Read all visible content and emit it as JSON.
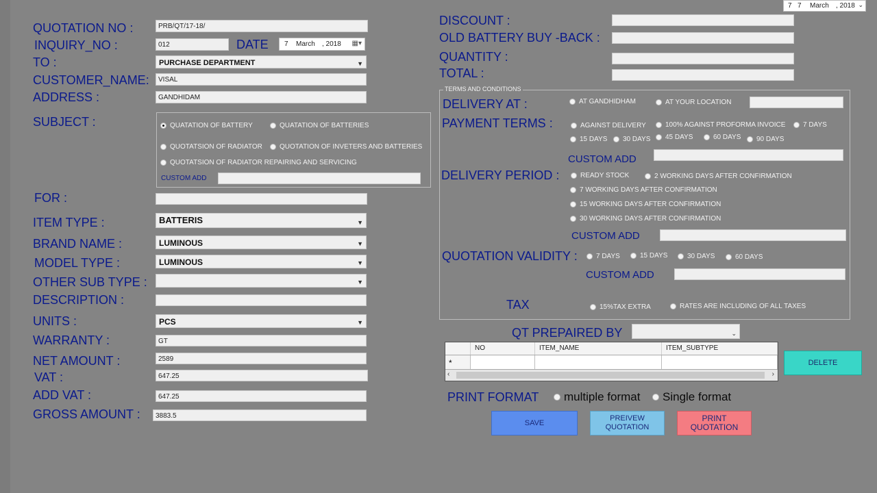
{
  "left": {
    "quotation_no": {
      "label": "QUOTATION NO :",
      "value": "PRB/QT/17-18/"
    },
    "inquiry_no": {
      "label": "INQUIRY_NO :",
      "value": "012"
    },
    "date": {
      "label": "DATE",
      "day": "7",
      "month": "March",
      "year": ", 2018"
    },
    "to": {
      "label": "TO :",
      "value": "PURCHASE DEPARTMENT"
    },
    "customer_name": {
      "label": "CUSTOMER_NAME:",
      "value": "VISAL"
    },
    "address": {
      "label": "ADDRESS :",
      "value": "GANDHIDAM"
    },
    "subject": {
      "label": "SUBJECT :",
      "options": [
        "QUATATION OF BATTERY",
        "QUATATION OF BATTERIES",
        "QUOTATSION OF  RADIATOR",
        "QUOTATION OF INVETERS AND BATTERIES",
        "QUOTATSION OF  RADIATOR REPAIRING AND SERVICING"
      ],
      "custom_add": "CUSTOM ADD"
    },
    "for": {
      "label": "FOR :",
      "value": ""
    },
    "item_type": {
      "label": "ITEM TYPE :",
      "value": "BATTERIS"
    },
    "brand_name": {
      "label": "BRAND NAME :",
      "value": "LUMINOUS"
    },
    "model_type": {
      "label": "MODEL TYPE :",
      "value": "LUMINOUS"
    },
    "other_sub_type": {
      "label": "OTHER SUB TYPE :",
      "value": ""
    },
    "description": {
      "label": "DESCRIPTION :",
      "value": ""
    },
    "units": {
      "label": "UNITS :",
      "value": "PCS"
    },
    "warranty": {
      "label": "WARRANTY :",
      "value": "GT"
    },
    "net_amount": {
      "label": "NET  AMOUNT :",
      "value": "2589"
    },
    "vat": {
      "label": "VAT :",
      "value": "647.25"
    },
    "add_vat": {
      "label": "ADD VAT :",
      "value": "647.25"
    },
    "gross_amount": {
      "label": "GROSS AMOUNT :",
      "value": "3883.5"
    }
  },
  "topdate": {
    "day1": "7",
    "day2": "7",
    "month": "March",
    "year": ", 2018"
  },
  "right": {
    "discount": {
      "label": "DISCOUNT :",
      "value": ""
    },
    "old_battery": {
      "label": "OLD BATTERY BUY -BACK :",
      "value": ""
    },
    "quantity": {
      "label": "QUANTITY :",
      "value": ""
    },
    "total": {
      "label": "TOTAL :",
      "value": ""
    },
    "terms_title": "TERMS AND CONDITIONS",
    "delivery_at": {
      "label": "DELIVERY AT :",
      "options": [
        "AT GANDHIDHAM",
        "AT YOUR LOCATION"
      ]
    },
    "payment_terms": {
      "label": "PAYMENT  TERMS :",
      "options": [
        "AGAINST DELIVERY",
        "100% AGAINST PROFORMA INVOICE",
        "7 DAYS",
        "15 DAYS",
        "30 DAYS",
        "45 DAYS",
        "60 DAYS",
        "90 DAYS"
      ],
      "custom_add": "CUSTOM ADD"
    },
    "delivery_period": {
      "label": "DELIVERY PERIOD :",
      "options": [
        "READY STOCK",
        "2 WORKING DAYS AFTER CONFIRMATION",
        "7 WORKING DAYS AFTER CONFIRMATION",
        "15 WORKING DAYS AFTER CONFIRMATION",
        "30 WORKING DAYS AFTER CONFIRMATION"
      ],
      "custom_add": "CUSTOM ADD"
    },
    "quotation_validity": {
      "label": "QUOTATION  VALIDITY :",
      "options": [
        "7 DAYS",
        "15 DAYS",
        "30 DAYS",
        "60 DAYS"
      ],
      "custom_add": "CUSTOM  ADD"
    },
    "tax": {
      "label": "TAX",
      "options": [
        "15%TAX EXTRA",
        "RATES ARE INCLUDING OF ALL TAXES"
      ]
    },
    "qt_prepared_by": {
      "label": "QT PREPAIRED BY",
      "value": ""
    },
    "grid": {
      "columns": [
        "NO",
        "ITEM_NAME",
        "ITEM_SUBTYPE"
      ],
      "new_row_marker": "*"
    },
    "delete_label": "DELETE",
    "print_format": {
      "label": "PRINT FORMAT",
      "options": [
        "multiple format",
        "Single format"
      ]
    },
    "save_label": "SAVE",
    "preview_label": "PREIVEW QUOTATION",
    "print_label": "PRINT QUOTATION"
  },
  "colors": {
    "background": "#848484",
    "label": "#0b1a8c",
    "save": "#5b8dee",
    "preview": "#7fc4e8",
    "print": "#f47c82",
    "delete": "#39d6c7"
  }
}
